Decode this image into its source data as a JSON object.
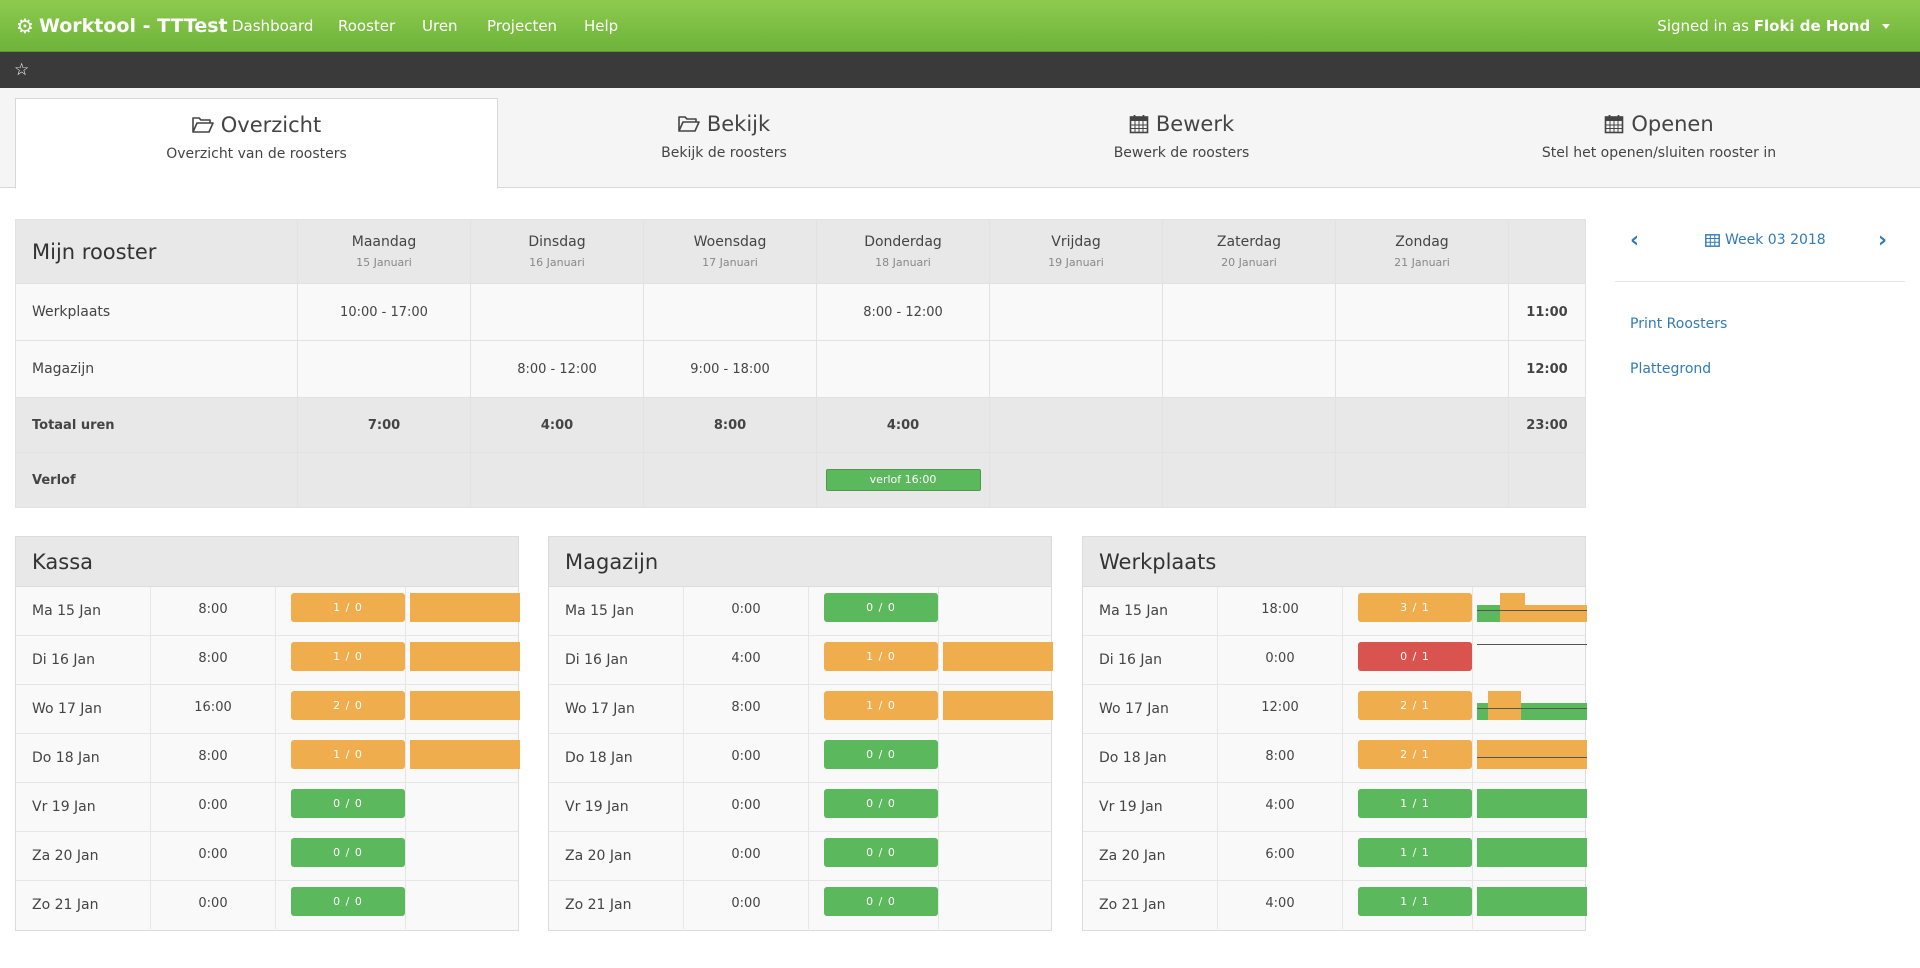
{
  "navbar": {
    "brand": "Worktool - TTTest",
    "links": [
      "Dashboard",
      "Rooster",
      "Uren",
      "Projecten",
      "Help"
    ],
    "signed_prefix": "Signed in as",
    "user": "Floki de Hond"
  },
  "tabs": [
    {
      "title": "Overzicht",
      "sub": "Overzicht van de roosters",
      "icon": "folder-open-icon"
    },
    {
      "title": "Bekijk",
      "sub": "Bekijk de roosters",
      "icon": "folder-open-icon"
    },
    {
      "title": "Bewerk",
      "sub": "Bewerk de roosters",
      "icon": "calendar-icon"
    },
    {
      "title": "Openen",
      "sub": "Stel het openen/sluiten rooster in",
      "icon": "calendar-icon"
    }
  ],
  "schedule": {
    "title": "Mijn rooster",
    "days": [
      {
        "name": "Maandag",
        "date": "15 Januari"
      },
      {
        "name": "Dinsdag",
        "date": "16 Januari"
      },
      {
        "name": "Woensdag",
        "date": "17 Januari"
      },
      {
        "name": "Donderdag",
        "date": "18 Januari"
      },
      {
        "name": "Vrijdag",
        "date": "19 Januari"
      },
      {
        "name": "Zaterdag",
        "date": "20 Januari"
      },
      {
        "name": "Zondag",
        "date": "21 Januari"
      }
    ],
    "rows": [
      {
        "label": "Werkplaats",
        "cells": [
          "10:00 - 17:00",
          "",
          "",
          "8:00 - 12:00",
          "",
          "",
          ""
        ],
        "total": "11:00"
      },
      {
        "label": "Magazijn",
        "cells": [
          "",
          "8:00 - 12:00",
          "9:00 - 18:00",
          "",
          "",
          "",
          ""
        ],
        "total": "12:00"
      }
    ],
    "totals": {
      "label": "Totaal uren",
      "cells": [
        "7:00",
        "4:00",
        "8:00",
        "4:00",
        "",
        "",
        ""
      ],
      "total": "23:00"
    },
    "verlof": {
      "label": "Verlof",
      "day_index": 3,
      "text": "verlof 16:00"
    }
  },
  "weeknav": {
    "label": "Week 03 2018"
  },
  "side_links": [
    "Print Roosters",
    "Plattegrond"
  ],
  "colors": {
    "green": "#5cb85c",
    "orange": "#f0ad4e",
    "red": "#d9534f"
  },
  "panels": [
    {
      "title": "Kassa",
      "rows": [
        {
          "day": "Ma 15 Jan",
          "hours": "8:00",
          "badge": "1 / 0",
          "status": "orange",
          "graph": [
            [
              "orange",
              0,
              1
            ]
          ],
          "lines": []
        },
        {
          "day": "Di 16 Jan",
          "hours": "8:00",
          "badge": "1 / 0",
          "status": "orange",
          "graph": [
            [
              "orange",
              0,
              1
            ]
          ],
          "lines": []
        },
        {
          "day": "Wo 17 Jan",
          "hours": "16:00",
          "badge": "2 / 0",
          "status": "orange",
          "graph": [
            [
              "orange",
              0,
              1
            ]
          ],
          "lines": []
        },
        {
          "day": "Do 18 Jan",
          "hours": "8:00",
          "badge": "1 / 0",
          "status": "orange",
          "graph": [
            [
              "orange",
              0,
              1
            ]
          ],
          "lines": []
        },
        {
          "day": "Vr 19 Jan",
          "hours": "0:00",
          "badge": "0 / 0",
          "status": "green",
          "graph": [],
          "lines": []
        },
        {
          "day": "Za 20 Jan",
          "hours": "0:00",
          "badge": "0 / 0",
          "status": "green",
          "graph": [],
          "lines": []
        },
        {
          "day": "Zo 21 Jan",
          "hours": "0:00",
          "badge": "0 / 0",
          "status": "green",
          "graph": [],
          "lines": []
        }
      ]
    },
    {
      "title": "Magazijn",
      "rows": [
        {
          "day": "Ma 15 Jan",
          "hours": "0:00",
          "badge": "0 / 0",
          "status": "green",
          "graph": [],
          "lines": []
        },
        {
          "day": "Di 16 Jan",
          "hours": "4:00",
          "badge": "1 / 0",
          "status": "orange",
          "graph": [
            [
              "orange",
              0,
              1
            ]
          ],
          "lines": []
        },
        {
          "day": "Wo 17 Jan",
          "hours": "8:00",
          "badge": "1 / 0",
          "status": "orange",
          "graph": [
            [
              "orange",
              0,
              1
            ]
          ],
          "lines": []
        },
        {
          "day": "Do 18 Jan",
          "hours": "0:00",
          "badge": "0 / 0",
          "status": "green",
          "graph": [],
          "lines": []
        },
        {
          "day": "Vr 19 Jan",
          "hours": "0:00",
          "badge": "0 / 0",
          "status": "green",
          "graph": [],
          "lines": []
        },
        {
          "day": "Za 20 Jan",
          "hours": "0:00",
          "badge": "0 / 0",
          "status": "green",
          "graph": [],
          "lines": []
        },
        {
          "day": "Zo 21 Jan",
          "hours": "0:00",
          "badge": "0 / 0",
          "status": "green",
          "graph": [],
          "lines": []
        }
      ]
    },
    {
      "title": "Werkplaats",
      "rows": [
        {
          "day": "Ma 15 Jan",
          "hours": "18:00",
          "badge": "3 / 1",
          "status": "orange",
          "graph": [
            [
              "green",
              0,
              0.22
            ],
            [
              "orange",
              0.21,
              0.44
            ],
            [
              "orange",
              0.44,
              1
            ]
          ],
          "lines": [
            0.58
          ]
        },
        {
          "day": "Di 16 Jan",
          "hours": "0:00",
          "badge": "0 / 1",
          "status": "red",
          "graph": [],
          "lines": [
            0.08
          ]
        },
        {
          "day": "Wo 17 Jan",
          "hours": "12:00",
          "badge": "2 / 1",
          "status": "orange",
          "graph": [
            [
              "green",
              0,
              1
            ],
            [
              "orange",
              0.1,
              0.4
            ]
          ],
          "lines": [
            0.58
          ]
        },
        {
          "day": "Do 18 Jan",
          "hours": "8:00",
          "badge": "2 / 1",
          "status": "orange",
          "graph": [
            [
              "orange",
              0,
              1
            ]
          ],
          "lines": [
            0.58
          ]
        },
        {
          "day": "Vr 19 Jan",
          "hours": "4:00",
          "badge": "1 / 1",
          "status": "green",
          "graph": [
            [
              "green",
              0,
              1
            ]
          ],
          "lines": []
        },
        {
          "day": "Za 20 Jan",
          "hours": "6:00",
          "badge": "1 / 1",
          "status": "green",
          "graph": [
            [
              "green",
              0,
              1
            ]
          ],
          "lines": []
        },
        {
          "day": "Zo 21 Jan",
          "hours": "4:00",
          "badge": "1 / 1",
          "status": "green",
          "graph": [
            [
              "green",
              0,
              1
            ]
          ],
          "lines": []
        }
      ]
    }
  ]
}
